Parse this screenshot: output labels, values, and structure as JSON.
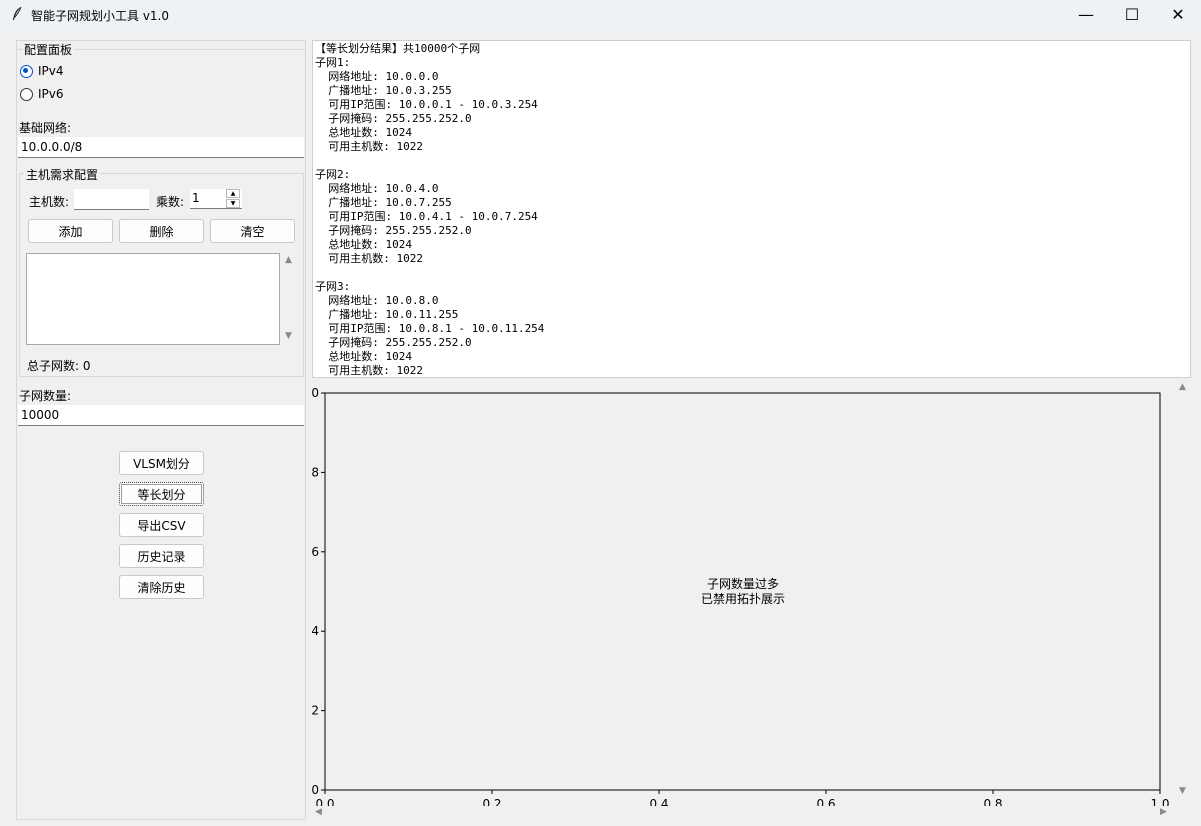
{
  "window": {
    "title": "智能子网规划小工具 v1.0",
    "minimize": "—",
    "maximize": "☐",
    "close": "✕"
  },
  "config": {
    "panel_title": "配置面板",
    "ipv4_label": "IPv4",
    "ipv6_label": "IPv6",
    "selected_version": "IPv4",
    "base_network_label": "基础网络:",
    "base_network_value": "10.0.0.0/8"
  },
  "host_config": {
    "group_title": "主机需求配置",
    "host_count_label": "主机数:",
    "host_count_value": "",
    "multiplier_label": "乘数:",
    "multiplier_value": "1",
    "add_label": "添加",
    "delete_label": "删除",
    "clear_label": "清空",
    "total_subnets_label": "总子网数: 0"
  },
  "subnet_count": {
    "label": "子网数量:",
    "value": "10000"
  },
  "actions": {
    "vlsm": "VLSM划分",
    "equal": "等长划分",
    "export_csv": "导出CSV",
    "history": "历史记录",
    "clear_history": "清除历史"
  },
  "output": {
    "text": "【等长划分结果】共10000个子网\n子网1:\n  网络地址: 10.0.0.0\n  广播地址: 10.0.3.255\n  可用IP范围: 10.0.0.1 - 10.0.3.254\n  子网掩码: 255.255.252.0\n  总地址数: 1024\n  可用主机数: 1022\n\n子网2:\n  网络地址: 10.0.4.0\n  广播地址: 10.0.7.255\n  可用IP范围: 10.0.4.1 - 10.0.7.254\n  子网掩码: 255.255.252.0\n  总地址数: 1024\n  可用主机数: 1022\n\n子网3:\n  网络地址: 10.0.8.0\n  广播地址: 10.0.11.255\n  可用IP范围: 10.0.8.1 - 10.0.11.254\n  子网掩码: 255.255.252.0\n  总地址数: 1024\n  可用主机数: 1022"
  },
  "plot": {
    "message_line1": "子网数量过多",
    "message_line2": "已禁用拓扑展示",
    "y_ticks": [
      "0",
      "8",
      "6",
      "4",
      "2",
      "0"
    ],
    "x_ticks": [
      "0.0",
      "0.2",
      "0.4",
      "0.6",
      "0.8",
      "1.0"
    ]
  }
}
